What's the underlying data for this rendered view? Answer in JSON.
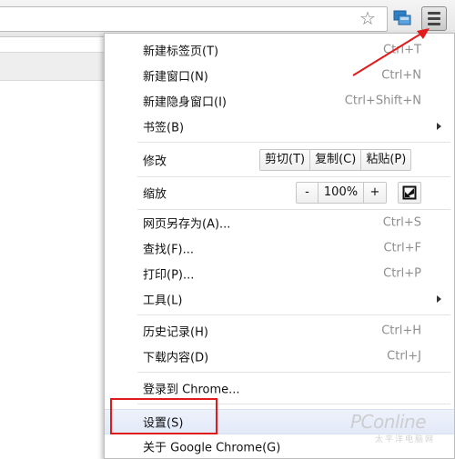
{
  "toolbar": {
    "icons": [
      "star-icon",
      "extension-icon",
      "hamburger-menu-icon"
    ]
  },
  "menu": {
    "items": [
      {
        "label": "新建标签页(T)",
        "shortcut": "Ctrl+T"
      },
      {
        "label": "新建窗口(N)",
        "shortcut": "Ctrl+N"
      },
      {
        "label": "新建隐身窗口(I)",
        "shortcut": "Ctrl+Shift+N"
      },
      {
        "label": "书签(B)",
        "shortcut": ""
      },
      {
        "label": "修改",
        "shortcut": ""
      },
      {
        "label": "缩放",
        "shortcut": ""
      },
      {
        "label": "网页另存为(A)...",
        "shortcut": "Ctrl+S"
      },
      {
        "label": "查找(F)...",
        "shortcut": "Ctrl+F"
      },
      {
        "label": "打印(P)...",
        "shortcut": "Ctrl+P"
      },
      {
        "label": "工具(L)",
        "shortcut": ""
      },
      {
        "label": "历史记录(H)",
        "shortcut": "Ctrl+H"
      },
      {
        "label": "下载内容(D)",
        "shortcut": "Ctrl+J"
      },
      {
        "label": "登录到 Chrome...",
        "shortcut": ""
      },
      {
        "label": "设置(S)",
        "shortcut": ""
      },
      {
        "label": "关于 Google Chrome(G)",
        "shortcut": ""
      }
    ],
    "edit": {
      "cut": "剪切(T)",
      "copy": "复制(C)",
      "paste": "粘贴(P)"
    },
    "zoom": {
      "minus": "-",
      "value": "100%",
      "plus": "+"
    }
  },
  "annotations": {
    "highlight_color": "#e01b1b"
  },
  "watermark": {
    "brand": "PConline",
    "sub": "太平洋电脑网"
  }
}
